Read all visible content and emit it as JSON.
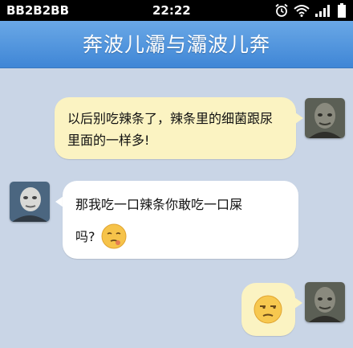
{
  "status_bar": {
    "carrier": "BB2B2BB",
    "time": "22:22",
    "icons": [
      "alarm-icon",
      "wifi-icon",
      "signal-icon",
      "battery-icon"
    ]
  },
  "header": {
    "title": "奔波儿灞与灞波儿奔"
  },
  "messages": [
    {
      "sender": "right-contact",
      "text": "以后别吃辣条了，辣条里的细菌跟尿里面的一样多!",
      "bubble_color": "#fbf3c2"
    },
    {
      "sender": "left-contact",
      "text_line1": "那我吃一口辣条你敢吃一口屎",
      "text_line2": "吗?",
      "emoji": "pensive-face-emoji",
      "bubble_color": "#ffffff"
    },
    {
      "sender": "right-contact",
      "emoji": "unamused-face-emoji",
      "bubble_color": "#fbf3c2"
    }
  ],
  "colors": {
    "background": "#c9d5e6",
    "header": "#4f92dc",
    "status_bar": "#000000"
  }
}
